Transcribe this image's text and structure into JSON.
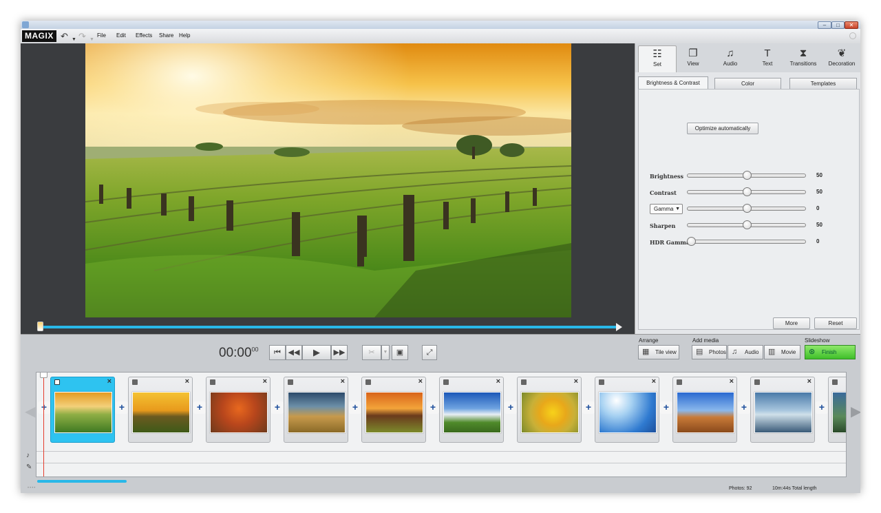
{
  "menubar": {
    "logo": "MAGIX",
    "menus": [
      "File",
      "Edit",
      "Effects",
      "Share",
      "Help"
    ]
  },
  "effects_panel": {
    "tabs": [
      {
        "label": "Set",
        "icon": "set-icon",
        "glyph": "☷"
      },
      {
        "label": "View",
        "icon": "view-icon",
        "glyph": "❐"
      },
      {
        "label": "Audio",
        "icon": "audio-icon",
        "glyph": "♫"
      },
      {
        "label": "Text",
        "icon": "text-icon",
        "glyph": "T"
      },
      {
        "label": "Transitions",
        "icon": "transitions-icon",
        "glyph": "⧗"
      },
      {
        "label": "Decoration",
        "icon": "decoration-icon",
        "glyph": "❦"
      }
    ],
    "subtabs": [
      "Brightness & Contrast",
      "Color",
      "Templates"
    ],
    "optimize_label": "Optimize automatically",
    "sliders": [
      {
        "label": "Brightness",
        "value": "50",
        "level": 0.5
      },
      {
        "label": "Contrast",
        "value": "50",
        "level": 0.5
      },
      {
        "label": "Gamma",
        "value": "0",
        "level": 0.5,
        "is_select": true
      },
      {
        "label": "Sharpen",
        "value": "50",
        "level": 0.5
      },
      {
        "label": "HDR Gamma",
        "value": "0",
        "level": 0.0
      }
    ],
    "more_label": "More",
    "reset_label": "Reset"
  },
  "transport": {
    "timecode": "00:00",
    "timecode_frames": "00"
  },
  "groups": {
    "arrange": "Arrange",
    "add_media": "Add media",
    "slideshow": "Slideshow"
  },
  "buttons": {
    "tile_view": "Tile view",
    "photos": "Photos",
    "audio": "Audio",
    "movie": "Movie",
    "finish": "Finish"
  },
  "status": {
    "photos": "Photos: 92",
    "length": "10m:44s Total length"
  },
  "colors": {
    "accent": "#29b8e8",
    "finish_green": "#3fbf2a",
    "selected_slide": "#2ec3f0"
  }
}
